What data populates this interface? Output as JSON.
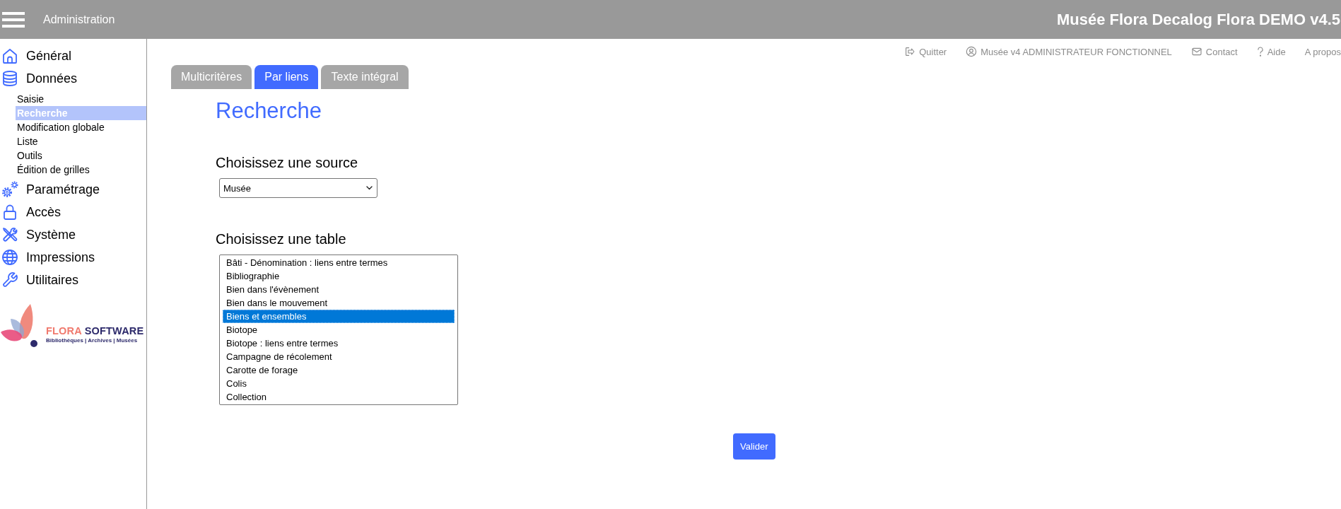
{
  "header": {
    "title": "Administration",
    "app_title": "Musée Flora Decalog Flora DEMO v4.5"
  },
  "top_links": [
    {
      "kind": "logout",
      "label": "Quitter"
    },
    {
      "kind": "user",
      "label": "Musée v4 ADMINISTRATEUR FONCTIONNEL"
    },
    {
      "kind": "contact",
      "label": "Contact"
    },
    {
      "kind": "help",
      "label": "Aide"
    },
    {
      "kind": "about",
      "label": "A propos"
    }
  ],
  "sidebar": {
    "items": [
      {
        "kind": "general",
        "label": "Général"
      },
      {
        "kind": "data",
        "label": "Données",
        "children": [
          {
            "label": "Saisie",
            "selected": false
          },
          {
            "label": "Recherche",
            "selected": true
          },
          {
            "label": "Modification globale",
            "selected": false
          },
          {
            "label": "Liste",
            "selected": false
          },
          {
            "label": "Outils",
            "selected": false
          },
          {
            "label": "Édition de grilles",
            "selected": false
          }
        ]
      },
      {
        "kind": "settings",
        "label": "Paramétrage"
      },
      {
        "kind": "access",
        "label": "Accès"
      },
      {
        "kind": "system",
        "label": "Système"
      },
      {
        "kind": "prints",
        "label": "Impressions"
      },
      {
        "kind": "utilities",
        "label": "Utilitaires"
      }
    ],
    "logo": {
      "brand": [
        "FLORA",
        "SOFTWARE"
      ],
      "tagline": "Bibliothèques | Archives | Musées"
    }
  },
  "tabs": [
    {
      "label": "Multicritères",
      "selected": false
    },
    {
      "label": "Par liens",
      "selected": true
    },
    {
      "label": "Texte intégral",
      "selected": false
    }
  ],
  "page_title": "Recherche",
  "source": {
    "label": "Choisissez une source",
    "value": "Musée"
  },
  "table": {
    "label": "Choisissez une table",
    "options": [
      {
        "label": "Bâti - Dénomination : liens entre termes",
        "selected": false
      },
      {
        "label": "Bibliographie",
        "selected": false
      },
      {
        "label": "Bien dans l'évènement",
        "selected": false
      },
      {
        "label": "Bien dans le mouvement",
        "selected": false
      },
      {
        "label": "Biens et ensembles",
        "selected": true
      },
      {
        "label": "Biotope",
        "selected": false
      },
      {
        "label": "Biotope : liens entre termes",
        "selected": false
      },
      {
        "label": "Campagne de récolement",
        "selected": false
      },
      {
        "label": "Carotte de forage",
        "selected": false
      },
      {
        "label": "Colis",
        "selected": false
      },
      {
        "label": "Collection",
        "selected": false
      }
    ]
  },
  "submit": "Valider"
}
